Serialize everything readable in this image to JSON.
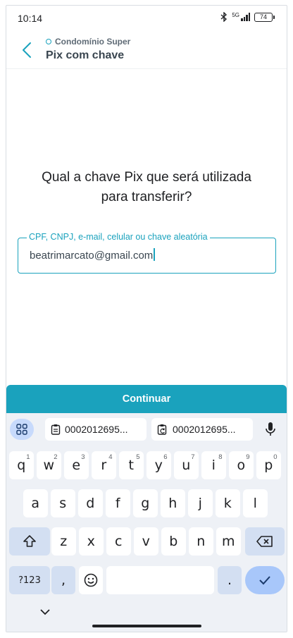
{
  "status_bar": {
    "time": "10:14",
    "network": "5G",
    "battery": "74"
  },
  "header": {
    "subtitle": "Condomínio Super",
    "title": "Pix com chave"
  },
  "main": {
    "question": "Qual a chave Pix que será utilizada para transferir?",
    "field": {
      "label": "CPF, CNPJ, e-mail, celular ou chave aleatória",
      "value": "beatrimarcato@gmail.com"
    },
    "continue_label": "Continuar"
  },
  "keyboard": {
    "clipboard": [
      "0002012695...",
      "0002012695..."
    ],
    "row1": [
      {
        "k": "q",
        "h": "1"
      },
      {
        "k": "w",
        "h": "2"
      },
      {
        "k": "e",
        "h": "3"
      },
      {
        "k": "r",
        "h": "4"
      },
      {
        "k": "t",
        "h": "5"
      },
      {
        "k": "y",
        "h": "6"
      },
      {
        "k": "u",
        "h": "7"
      },
      {
        "k": "i",
        "h": "8"
      },
      {
        "k": "o",
        "h": "9"
      },
      {
        "k": "p",
        "h": "0"
      }
    ],
    "row2": [
      "a",
      "s",
      "d",
      "f",
      "g",
      "h",
      "j",
      "k",
      "l"
    ],
    "row3": [
      "z",
      "x",
      "c",
      "v",
      "b",
      "n",
      "m"
    ],
    "symbols_label": "?123",
    "comma_label": ",",
    "period_label": "."
  }
}
